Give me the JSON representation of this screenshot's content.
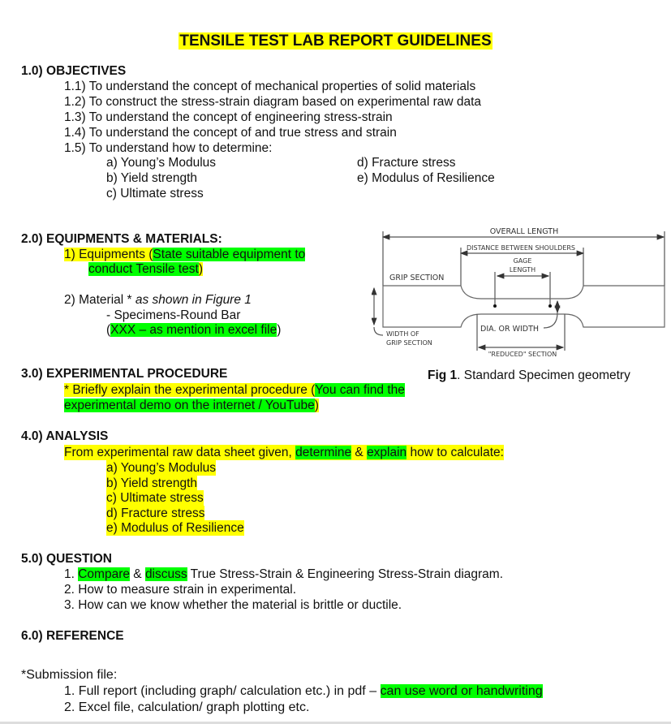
{
  "title": "TENSILE TEST LAB REPORT GUIDELINES",
  "objectives": {
    "heading": "1.0) OBJECTIVES",
    "items": [
      "1.1) To understand the concept of mechanical properties of solid materials",
      "1.2) To construct the stress-strain diagram based on experimental raw data",
      "1.3) To understand the concept of engineering stress-strain",
      "1.4) To understand the concept of and true stress and strain",
      "1.5) To understand how to determine:"
    ],
    "sub_left": [
      "a) Young’s Modulus",
      "b) Yield strength",
      "c) Ultimate stress"
    ],
    "sub_right": [
      "d) Fracture stress",
      "e) Modulus of Resilience"
    ]
  },
  "equipment": {
    "heading": "2.0) EQUIPMENTS & MATERIALS:",
    "item1_prefix": "1)  Equipments (",
    "item1_highlight_a": "State suitable equipment to",
    "item1_highlight_b": "conduct Tensile test",
    "item1_suffix": ")",
    "item2_prefix": "2)  Material * ",
    "item2_italic": "as shown in Figure 1",
    "item2_sub": "- Specimens-Round Bar",
    "item2_paren_open": "(",
    "item2_highlight": "XXX – as mention in excel file",
    "item2_paren_close": ")"
  },
  "figure": {
    "labels": {
      "overall": "OVERALL LENGTH",
      "shoulders": "DISTANCE BETWEEN SHOULDERS",
      "gage1": "GAGE",
      "gage2": "LENGTH",
      "grip": "GRIP SECTION",
      "width1": "WIDTH OF",
      "width2": "GRIP SECTION",
      "dia": "DIA. OR WIDTH",
      "reduced": "\"REDUCED\" SECTION"
    },
    "caption_bold": "Fig 1",
    "caption_rest": ". Standard Specimen geometry"
  },
  "procedure": {
    "heading": "3.0) EXPERIMENTAL PROCEDURE",
    "line1_yellow": "* Briefly explain the experimental procedure (",
    "line1_green": "You can find the",
    "line2_green": "experimental demo on the internet / YouTube",
    "line2_yellow": ")"
  },
  "analysis": {
    "heading": "4.0) ANALYSIS",
    "intro_a": "From experimental raw data sheet given, ",
    "intro_g1": "determine",
    "intro_b": " & ",
    "intro_g2": "explain",
    "intro_c": " how to calculate:",
    "items": [
      "a) Young’s Modulus",
      "b) Yield strength",
      "c) Ultimate stress",
      "d) Fracture stress",
      "e) Modulus of Resilience"
    ]
  },
  "question": {
    "heading": "5.0) QUESTION",
    "q1_num": "1. ",
    "q1_g1": "Compare",
    "q1_mid": " & ",
    "q1_g2": "discuss",
    "q1_rest": " True Stress-Strain & Engineering Stress-Strain diagram.",
    "q2": "2. How to measure strain in experimental.",
    "q3": "3. How can we know whether the material is brittle or ductile."
  },
  "reference": {
    "heading": "6.0) REFERENCE"
  },
  "submission": {
    "label": "*Submission file:",
    "item1_text": "1. Full report (including graph/ calculation etc.) in pdf – ",
    "item1_highlight": "can use word or handwriting",
    "item2": "2. Excel file, calculation/ graph plotting etc."
  }
}
